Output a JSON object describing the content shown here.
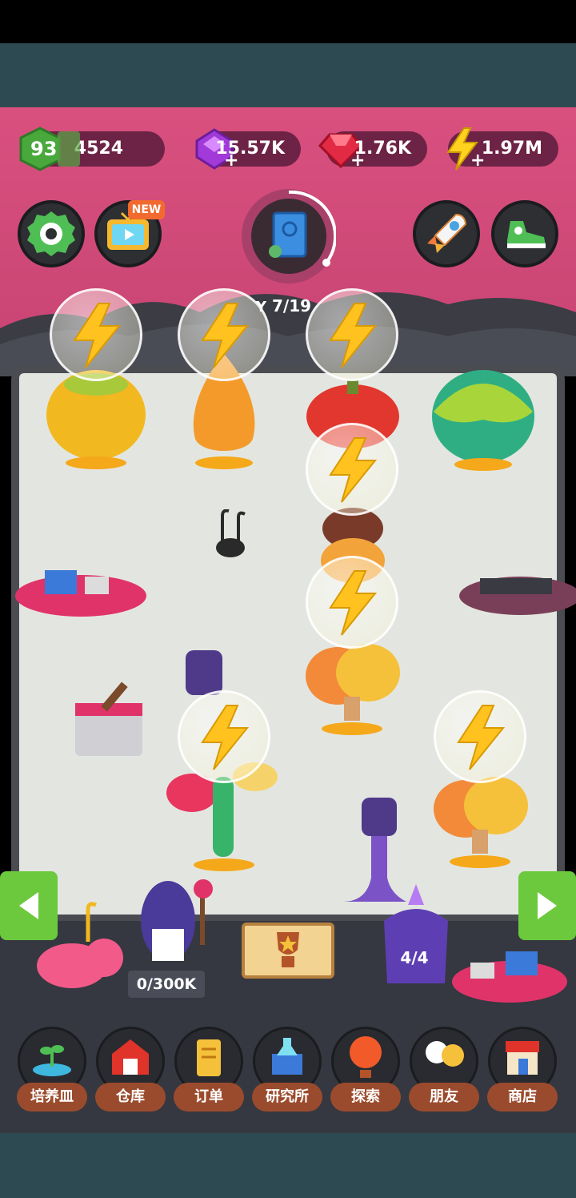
{
  "hud": {
    "level": "93",
    "xp": "4524",
    "purple_gems": "15.57K",
    "red_gems": "1.76K",
    "energy": "1.97M",
    "new_badge": "NEW",
    "sprout_progress": "7/19"
  },
  "base": {
    "maid_counter": "0/300K",
    "crystal_counter": "4/4"
  },
  "dock": [
    {
      "label": "培养皿",
      "icon": "petri-dish-sprout-icon"
    },
    {
      "label": "仓库",
      "icon": "barn-icon"
    },
    {
      "label": "订单",
      "icon": "scroll-order-icon"
    },
    {
      "label": "研究所",
      "icon": "laboratory-icon"
    },
    {
      "label": "探索",
      "icon": "hot-air-balloon-icon"
    },
    {
      "label": "朋友",
      "icon": "friends-icon"
    },
    {
      "label": "商店",
      "icon": "shop-icon"
    }
  ],
  "colors": {
    "hud_pink": "#d9507f",
    "pill_dark": "#6d2345",
    "field_bg": "#e3e6e0",
    "nav_green": "#6cc93d",
    "dock_label": "#9b4b2d"
  }
}
